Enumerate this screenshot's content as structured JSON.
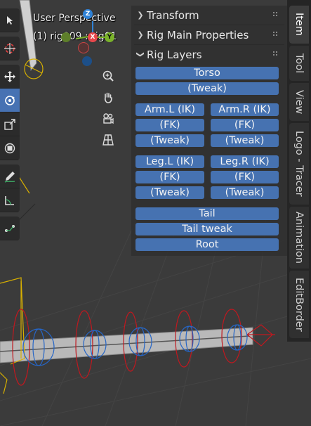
{
  "viewport": {
    "perspective_label": "User Perspective",
    "object_label": "(1) rig009 : rig01"
  },
  "gizmo": {
    "z": "Z",
    "x": "X",
    "y": "Y"
  },
  "toolbar": {
    "tools": [
      "select-box",
      "cursor",
      "move",
      "rotate",
      "scale",
      "transform",
      "annotate",
      "measure",
      "bone-roll",
      "bone-envelope",
      "extrude"
    ],
    "active_tool": "rotate"
  },
  "nav_buttons": [
    "zoom",
    "pan",
    "camera",
    "perspective-grid"
  ],
  "npanel": {
    "sections": {
      "transform": "Transform",
      "rig_main_properties": "Rig Main Properties",
      "rig_layers": "Rig Layers"
    },
    "rig_layers": {
      "torso": "Torso",
      "torso_tweak": "(Tweak)",
      "arm_l_ik": "Arm.L (IK)",
      "arm_r_ik": "Arm.R (IK)",
      "arm_l_fk": "(FK)",
      "arm_r_fk": "(FK)",
      "arm_l_tweak": "(Tweak)",
      "arm_r_tweak": "(Tweak)",
      "leg_l_ik": "Leg.L (IK)",
      "leg_r_ik": "Leg.R (IK)",
      "leg_l_fk": "(FK)",
      "leg_r_fk": "(FK)",
      "leg_l_tweak": "(Tweak)",
      "leg_r_tweak": "(Tweak)",
      "tail": "Tail",
      "tail_tweak": "Tail tweak",
      "root": "Root"
    }
  },
  "tabs": {
    "item": "Item",
    "tool": "Tool",
    "view": "View",
    "logo_tracer": "Logo - Tracer",
    "animation": "Animation",
    "editborder": "EditBorder",
    "active": "Item"
  },
  "colors": {
    "accent": "#4672b1",
    "gizmo_x": "#e8474b",
    "gizmo_y": "#7ab22a",
    "gizmo_z": "#2f82d6",
    "bone_red": "#c0181f",
    "bone_blue": "#2666c7",
    "selection_yellow": "#d9b100"
  }
}
